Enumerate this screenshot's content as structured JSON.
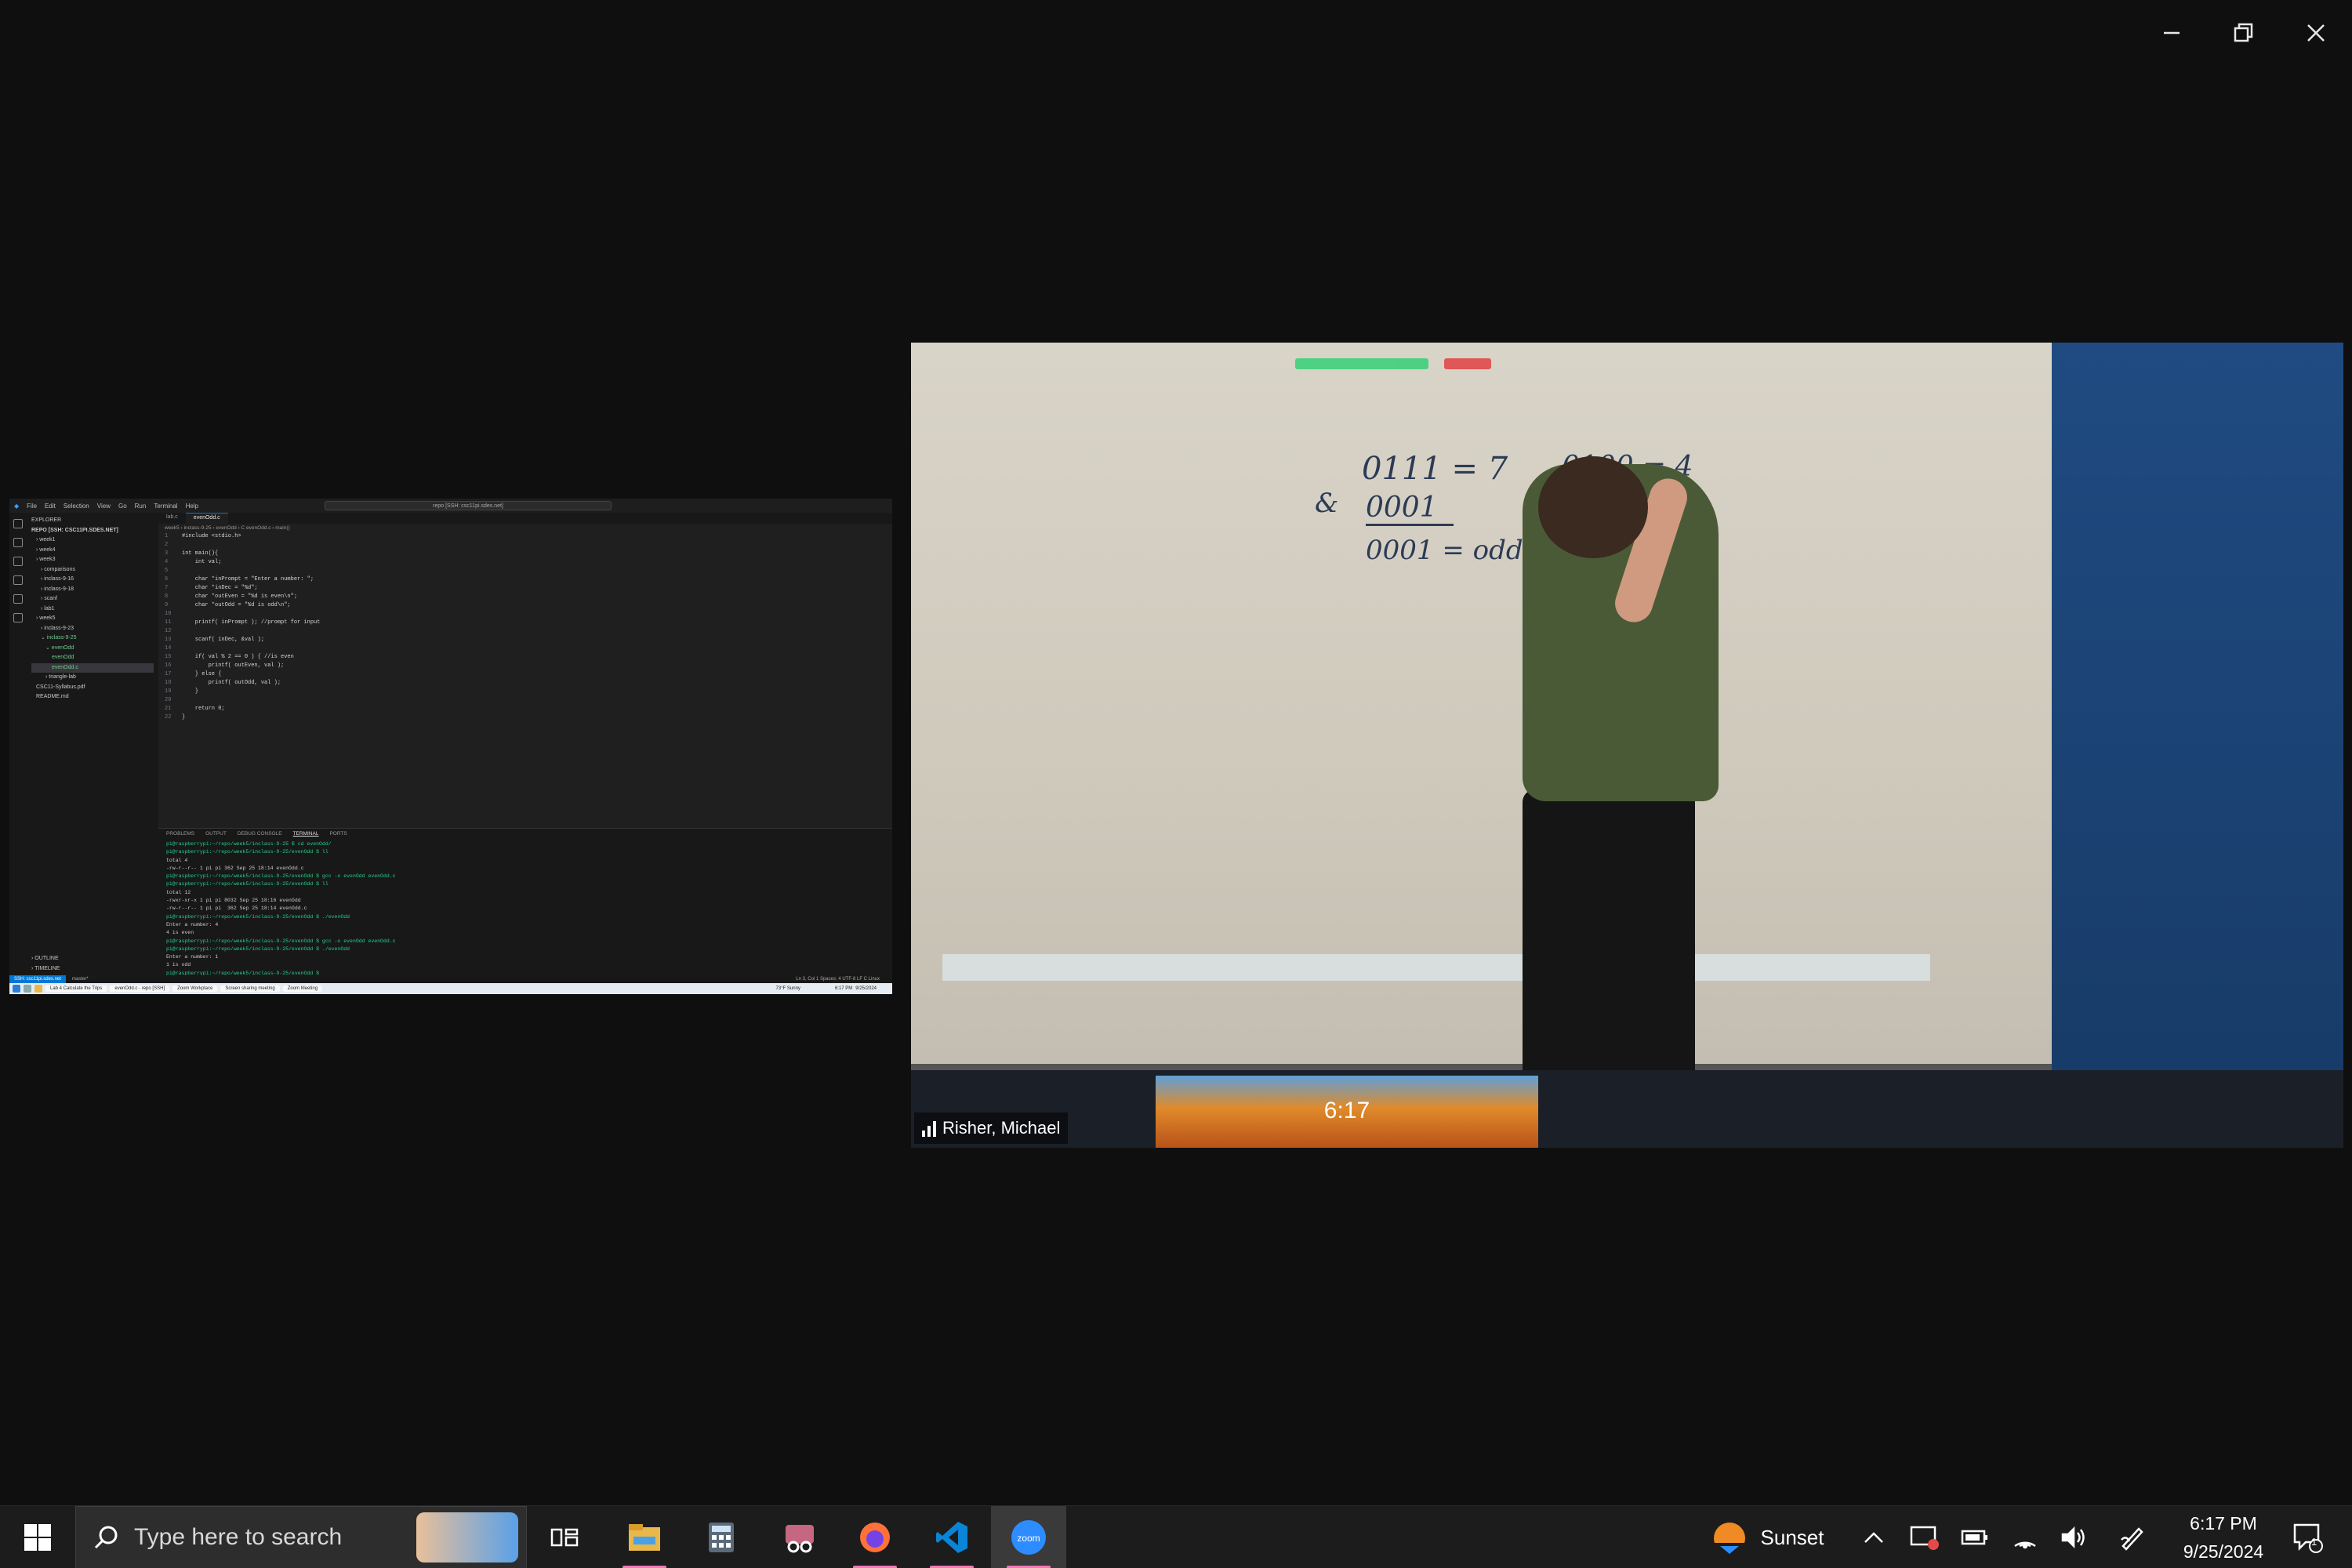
{
  "window": {
    "controls": [
      "minimize",
      "restore",
      "close"
    ]
  },
  "shared_screen": {
    "menu": [
      "File",
      "Edit",
      "Selection",
      "View",
      "Go",
      "Run",
      "Terminal",
      "Help"
    ],
    "search": "repo [SSH: csc11pi.sdes.net]",
    "explorer": {
      "header": "EXPLORER",
      "root": "REPO [SSH: CSC11PI.SDES.NET]",
      "items": [
        "› week1",
        "› week4",
        "› week3",
        "› comparisons",
        "› inclass-9-16",
        "› inclass-9-18",
        "› scanf",
        "› lab1",
        "› week5",
        "› inclass-9-23",
        "⌄ inclass-9-25",
        "⌄ evenOdd",
        "evenOdd",
        "evenOdd.c",
        "› triangle-lab",
        "CSC11-Syllabus.pdf",
        "README.md"
      ],
      "bottom": [
        "› OUTLINE",
        "› TIMELINE"
      ]
    },
    "tabs": [
      "lab.c",
      "evenOdd.c"
    ],
    "breadcrumb": "week5 › inclass-9-25 › evenOdd › C evenOdd.c › main()",
    "code": [
      "#include <stdio.h>",
      "",
      "int main(){",
      "    int val;",
      "",
      "    char *inPrompt = \"Enter a number: \";",
      "    char *inDec = \"%d\";",
      "    char *outEven = \"%d is even\\n\";",
      "    char *outOdd = \"%d is odd\\n\";",
      "",
      "    printf( inPrompt ); //prompt for input",
      "",
      "    scanf( inDec, &val );",
      "",
      "    if( val % 2 == 0 ) { //is even",
      "        printf( outEven, val );",
      "    } else {",
      "        printf( outOdd, val );",
      "    }",
      "",
      "    return 0;",
      "}"
    ],
    "terminal_tabs": [
      "PROBLEMS",
      "OUTPUT",
      "DEBUG CONSOLE",
      "TERMINAL",
      "PORTS"
    ],
    "terminal": [
      "pi@raspberrypi:~/repo/week5/inclass-9-25 $ cd evenOdd/",
      "pi@raspberrypi:~/repo/week5/inclass-9-25/evenOdd $ ll",
      "total 4",
      "-rw-r--r-- 1 pi pi 362 Sep 25 18:14 evenOdd.c",
      "pi@raspberrypi:~/repo/week5/inclass-9-25/evenOdd $ gcc -o evenOdd evenOdd.c",
      "pi@raspberrypi:~/repo/week5/inclass-9-25/evenOdd $ ll",
      "total 12",
      "-rwxr-xr-x 1 pi pi 8032 Sep 25 18:16 evenOdd",
      "-rw-r--r-- 1 pi pi  362 Sep 25 18:14 evenOdd.c",
      "pi@raspberrypi:~/repo/week5/inclass-9-25/evenOdd $ ./evenOdd",
      "Enter a number: 4",
      "4 is even",
      "pi@raspberrypi:~/repo/week5/inclass-9-25/evenOdd $ gcc -o evenOdd evenOdd.c",
      "pi@raspberrypi:~/repo/week5/inclass-9-25/evenOdd $ ./evenOdd",
      "Enter a number: 1",
      "1 is odd",
      "pi@raspberrypi:~/repo/week5/inclass-9-25/evenOdd $ "
    ],
    "status": {
      "remote": "SSH: csc11pi.sdes.net",
      "branch": "master*",
      "right": "Ln 3, Col 1   Spaces: 4   UTF-8   LF   C   Linux"
    },
    "inner_taskbar": {
      "apps": [
        "Lab 4 Calculate the Trips",
        "evenOdd.c - repo [SSH]",
        "Zoom Workplace",
        "Screen sharing meeting",
        "Zoom Meeting"
      ],
      "weather": "73°F Sunny",
      "time": "6:17 PM",
      "date": "9/25/2024"
    }
  },
  "video": {
    "participant": "Risher, Michael",
    "whiteboard": {
      "line1": "0111 = 7",
      "line2": "&",
      "line3": "0001",
      "line4": "0001 = odd",
      "line5": "0100 = 4"
    },
    "clock": "6:17"
  },
  "taskbar": {
    "search_placeholder": "Type here to search",
    "weather": "Sunset",
    "time": "6:17 PM",
    "date": "9/25/2024",
    "notifications": "1"
  }
}
